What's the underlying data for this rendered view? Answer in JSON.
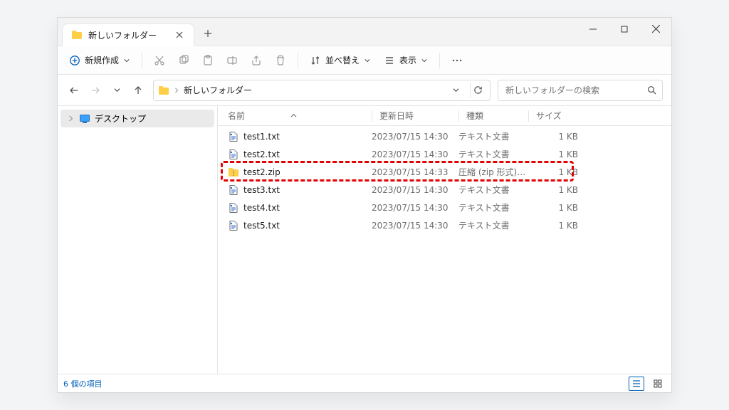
{
  "window": {
    "tab_title": "新しいフォルダー",
    "btn_new": "新規作成",
    "btn_sort": "並べ替え",
    "btn_view": "表示"
  },
  "address": {
    "crumb": "新しいフォルダー"
  },
  "search": {
    "placeholder": "新しいフォルダーの検索"
  },
  "tree": {
    "items": [
      {
        "label": "デスクトップ"
      }
    ]
  },
  "columns": {
    "name": "名前",
    "date": "更新日時",
    "type": "種類",
    "size": "サイズ"
  },
  "files": [
    {
      "name": "test1.txt",
      "date": "2023/07/15 14:30",
      "type": "テキスト文書",
      "size": "1 KB",
      "kind": "txt"
    },
    {
      "name": "test2.txt",
      "date": "2023/07/15 14:30",
      "type": "テキスト文書",
      "size": "1 KB",
      "kind": "txt"
    },
    {
      "name": "test2.zip",
      "date": "2023/07/15 14:33",
      "type": "圧縮 (zip 形式) フォ...",
      "size": "1 KB",
      "kind": "zip"
    },
    {
      "name": "test3.txt",
      "date": "2023/07/15 14:30",
      "type": "テキスト文書",
      "size": "1 KB",
      "kind": "txt"
    },
    {
      "name": "test4.txt",
      "date": "2023/07/15 14:30",
      "type": "テキスト文書",
      "size": "1 KB",
      "kind": "txt"
    },
    {
      "name": "test5.txt",
      "date": "2023/07/15 14:30",
      "type": "テキスト文書",
      "size": "1 KB",
      "kind": "txt"
    }
  ],
  "highlight_index": 2,
  "status": {
    "text": "6 個の項目"
  }
}
